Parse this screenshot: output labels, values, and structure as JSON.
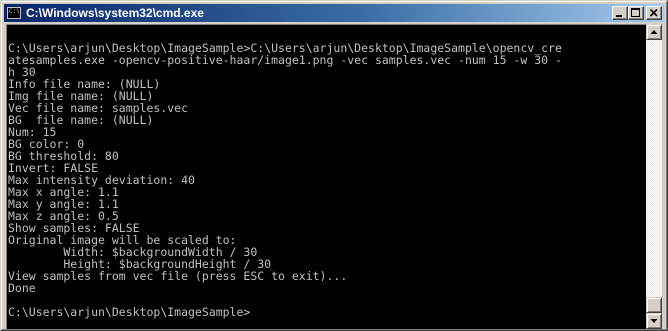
{
  "window": {
    "title": "C:\\Windows\\system32\\cmd.exe",
    "app_icon": "console-icon",
    "buttons": {
      "minimize_icon": "minimize-icon",
      "maximize_icon": "maximize-icon",
      "close_icon": "close-icon"
    }
  },
  "colors": {
    "titlebar_start": "#0a246a",
    "titlebar_end": "#a6caf0",
    "console_background": "#000000",
    "console_text": "#c0c0c0",
    "chrome": "#d4d0c8"
  },
  "console": {
    "lines": [
      "",
      "C:\\Users\\arjun\\Desktop\\ImageSample>C:\\Users\\arjun\\Desktop\\ImageSample\\opencv_cre",
      "atesamples.exe -opencv-positive-haar/image1.png -vec samples.vec -num 15 -w 30 -",
      "h 30",
      "Info file name: (NULL)",
      "Img file name: (NULL)",
      "Vec file name: samples.vec",
      "BG  file name: (NULL)",
      "Num: 15",
      "BG color: 0",
      "BG threshold: 80",
      "Invert: FALSE",
      "Max intensity deviation: 40",
      "Max x angle: 1.1",
      "Max y angle: 1.1",
      "Max z angle: 0.5",
      "Show samples: FALSE",
      "Original image will be scaled to:",
      "        Width: $backgroundWidth / 30",
      "        Height: $backgroundHeight / 30",
      "View samples from vec file (press ESC to exit)...",
      "Done",
      "",
      "C:\\Users\\arjun\\Desktop\\ImageSample>"
    ]
  },
  "scrollbar": {
    "up_icon": "scroll-up-arrow-icon",
    "down_icon": "scroll-down-arrow-icon",
    "scroll_position": 1.0
  }
}
